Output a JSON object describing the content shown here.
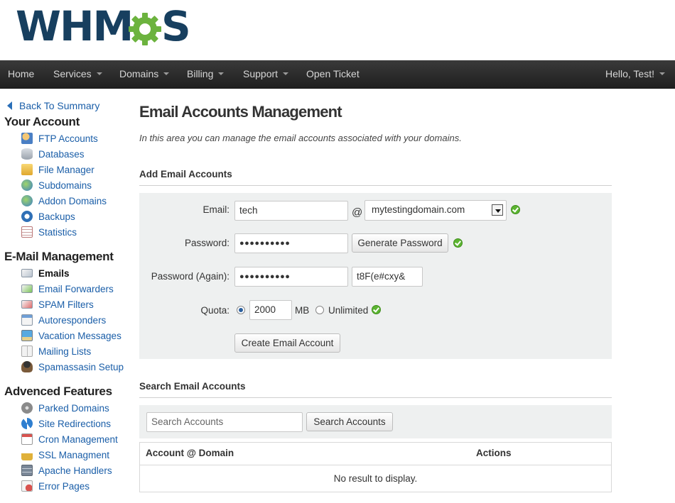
{
  "colors": {
    "brand_dark": "#173f5f",
    "brand_green": "#6cb33e",
    "navbar": "#2a2a2a",
    "link": "#1a5ea8",
    "success": "#5cb531"
  },
  "logo": {
    "left": "WHM",
    "right": "S"
  },
  "navbar": {
    "items": [
      {
        "label": "Home",
        "dropdown": false
      },
      {
        "label": "Services",
        "dropdown": true
      },
      {
        "label": "Domains",
        "dropdown": true
      },
      {
        "label": "Billing",
        "dropdown": true
      },
      {
        "label": "Support",
        "dropdown": true
      },
      {
        "label": "Open Ticket",
        "dropdown": false
      }
    ],
    "user": "Hello, Test!"
  },
  "sidebar": {
    "back_label": "Back To Summary",
    "your_account": {
      "title": "Your Account",
      "items": [
        {
          "label": "FTP Accounts",
          "icon": "ftp-user-icon"
        },
        {
          "label": "Databases",
          "icon": "database-icon"
        },
        {
          "label": "File Manager",
          "icon": "folder-icon"
        },
        {
          "label": "Subdomains",
          "icon": "globe-icon"
        },
        {
          "label": "Addon Domains",
          "icon": "globe-add-icon"
        },
        {
          "label": "Backups",
          "icon": "clock-icon"
        },
        {
          "label": "Statistics",
          "icon": "stats-icon"
        }
      ]
    },
    "email_management": {
      "title": "E-Mail Management",
      "items": [
        {
          "label": "Emails",
          "icon": "envelope-icon",
          "active": true
        },
        {
          "label": "Email Forwarders",
          "icon": "envelope-forward-icon"
        },
        {
          "label": "SPAM Filters",
          "icon": "envelope-block-icon"
        },
        {
          "label": "Autoresponders",
          "icon": "window-icon"
        },
        {
          "label": "Vacation Messages",
          "icon": "palm-tree-icon"
        },
        {
          "label": "Mailing Lists",
          "icon": "book-icon"
        },
        {
          "label": "Spamassasin Setup",
          "icon": "spy-icon"
        }
      ]
    },
    "advanced_features": {
      "title": "Advenced Features",
      "items": [
        {
          "label": "Parked Domains",
          "icon": "disc-icon"
        },
        {
          "label": "Site Redirections",
          "icon": "refresh-arrows-icon"
        },
        {
          "label": "Cron Management",
          "icon": "calendar-icon"
        },
        {
          "label": "SSL Managment",
          "icon": "lock-icon"
        },
        {
          "label": "Apache Handlers",
          "icon": "server-icon"
        },
        {
          "label": "Error Pages",
          "icon": "error-page-icon"
        }
      ]
    }
  },
  "main": {
    "title": "Email Accounts Management",
    "description": "In this area you can manage the email accounts associated with your domains.",
    "add_section": {
      "heading": "Add Email Accounts",
      "email_label": "Email:",
      "email_value": "tech",
      "at_sign": "@",
      "domain_selected": "mytestingdomain.com",
      "password_label": "Password:",
      "password_value": "●●●●●●●●●●",
      "generate_label": "Generate Password",
      "password_again_label": "Password (Again):",
      "password_again_value": "●●●●●●●●●●",
      "generated_value": "t8F(e#cxy&",
      "quota_label": "Quota:",
      "quota_value": "2000",
      "quota_unit": "MB",
      "unlimited_label": "Unlimited",
      "create_label": "Create Email Account"
    },
    "search_section": {
      "heading": "Search Email Accounts",
      "search_placeholder": "Search Accounts",
      "search_button": "Search Accounts"
    },
    "table": {
      "columns": [
        "Account @ Domain",
        "Actions"
      ],
      "empty_text": "No result to display."
    }
  }
}
